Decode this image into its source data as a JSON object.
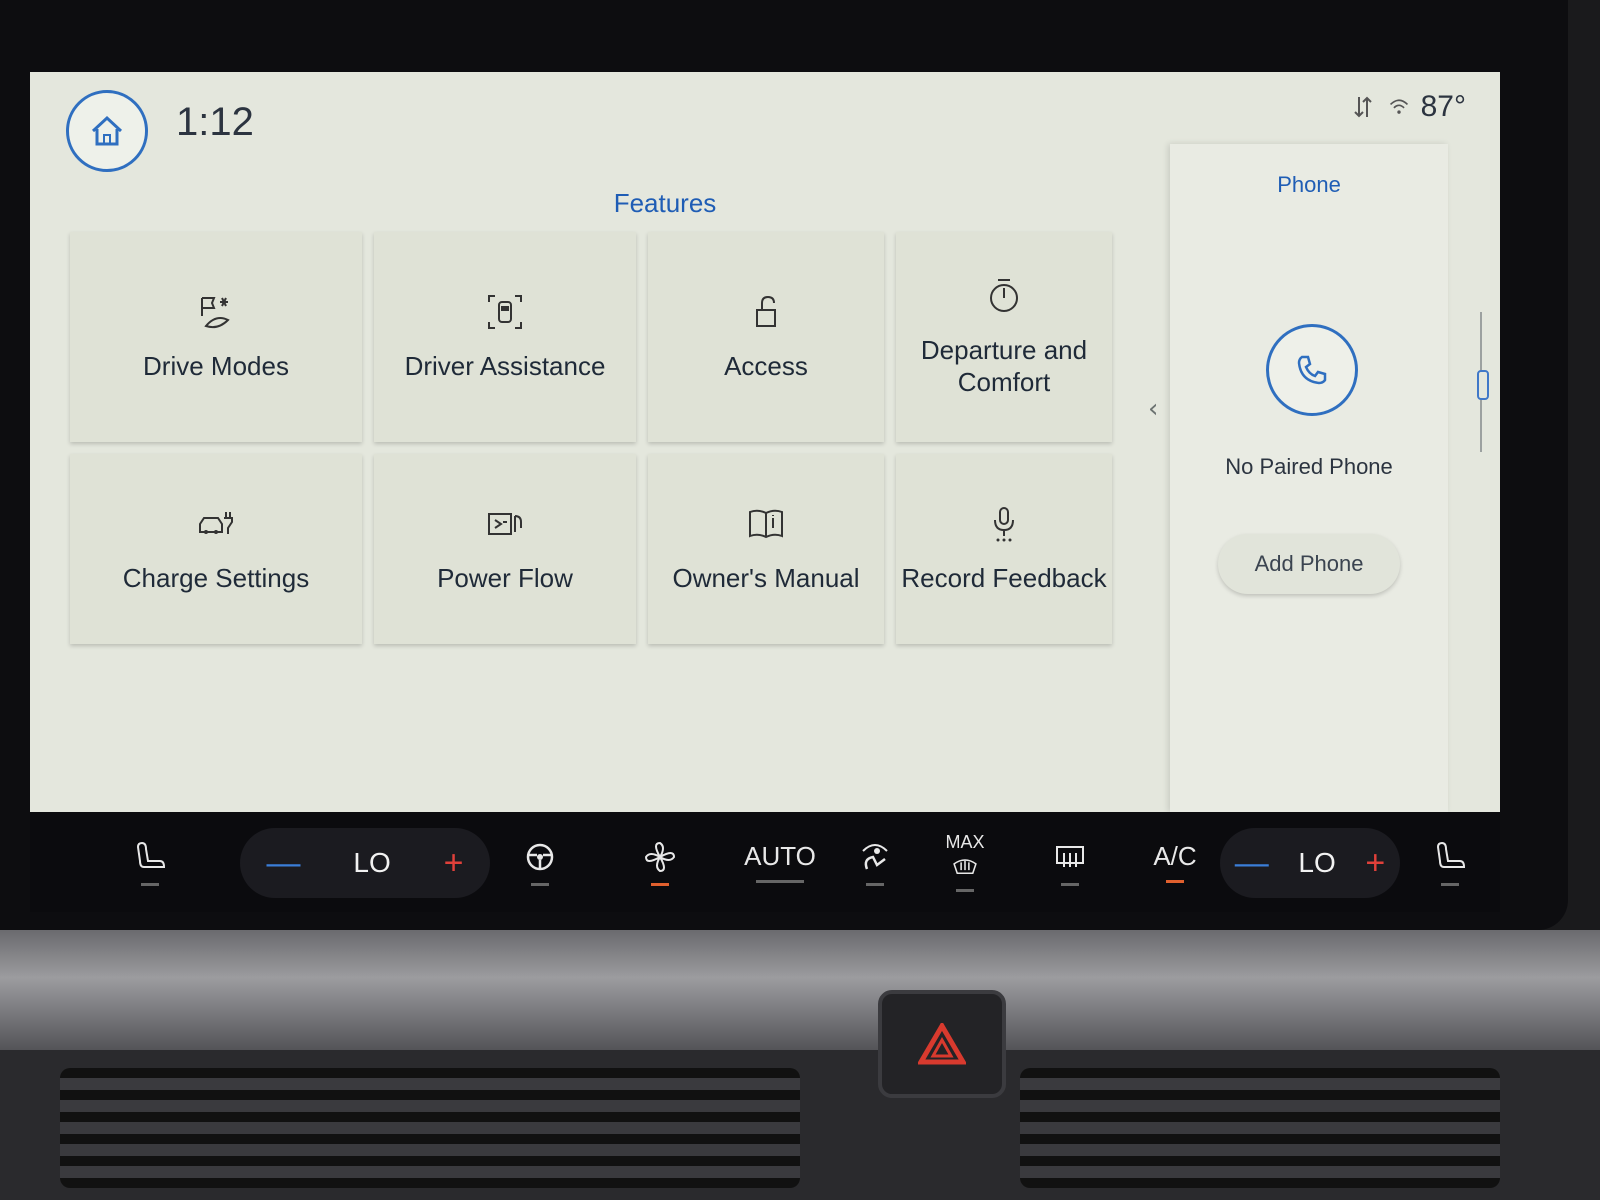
{
  "status": {
    "time": "1:12",
    "outside_temp": "87°"
  },
  "features": {
    "title": "Features",
    "tiles": [
      {
        "label": "Drive Modes",
        "icon": "drive-modes-icon"
      },
      {
        "label": "Driver Assistance",
        "icon": "driver-assist-icon"
      },
      {
        "label": "Access",
        "icon": "lock-icon"
      },
      {
        "label": "Departure and Comfort",
        "icon": "timer-icon"
      },
      {
        "label": "Charge Settings",
        "icon": "charge-icon"
      },
      {
        "label": "Power Flow",
        "icon": "power-flow-icon"
      },
      {
        "label": "Owner's Manual",
        "icon": "book-icon"
      },
      {
        "label": "Record Feedback",
        "icon": "microphone-icon"
      }
    ]
  },
  "phone": {
    "title": "Phone",
    "status": "No Paired Phone",
    "add_label": "Add Phone"
  },
  "climate": {
    "driver_temp": "LO",
    "passenger_temp": "LO",
    "auto_label": "AUTO",
    "max_label": "MAX",
    "ac_label": "A/C",
    "minus": "—",
    "plus": "+",
    "accent_on": "#e0602e"
  }
}
